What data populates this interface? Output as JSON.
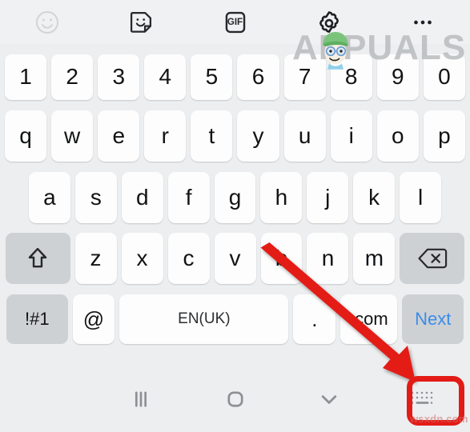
{
  "toolbar": {
    "items": [
      {
        "name": "emoji-icon",
        "label": "Emoji",
        "state": "inactive"
      },
      {
        "name": "sticker-icon",
        "label": "Sticker",
        "state": "active"
      },
      {
        "name": "gif-icon",
        "label": "GIF",
        "state": "active"
      },
      {
        "name": "settings-gear-icon",
        "label": "Settings",
        "state": "active"
      },
      {
        "name": "more-options-icon",
        "label": "More options",
        "state": "active"
      }
    ],
    "gif_label": "GIF"
  },
  "keyboard": {
    "rows": {
      "numbers": [
        "1",
        "2",
        "3",
        "4",
        "5",
        "6",
        "7",
        "8",
        "9",
        "0"
      ],
      "top": [
        "q",
        "w",
        "e",
        "r",
        "t",
        "y",
        "u",
        "i",
        "o",
        "p"
      ],
      "home": [
        "a",
        "s",
        "d",
        "f",
        "g",
        "h",
        "j",
        "k",
        "l"
      ],
      "bottom": [
        "z",
        "x",
        "c",
        "v",
        "b",
        "n",
        "m"
      ]
    },
    "shift_key": {
      "label": "",
      "icon": "shift-arrow-icon"
    },
    "backspace_key": {
      "label": "",
      "icon": "backspace-icon"
    },
    "function_row": {
      "symbols_label": "!#1",
      "at_label": "@",
      "space_label": "EN(UK)",
      "period_label": ".",
      "dotcom_label": ".com",
      "enter_label": "Next"
    }
  },
  "navbar": {
    "recents_label": "Recents",
    "home_label": "Home",
    "hide_keyboard_label": "Hide keyboard",
    "keyboard_switch_label": "Change keyboard"
  },
  "annotation": {
    "highlight_color": "#e31b16",
    "arrow_label": "Points to keyboard switch button"
  },
  "watermarks": {
    "brand": "APPUALS",
    "bottom": "wsxdn.com"
  },
  "colors": {
    "keyboard_background": "#eceef0",
    "toolbar_background": "#eff1f2",
    "key_background": "#fdfdfd",
    "key_gray_background": "#ced1d4",
    "key_text": "#111315",
    "enter_text": "#3d8ce8",
    "highlight_red": "#e31b16",
    "nav_icon": "#8d9094"
  }
}
